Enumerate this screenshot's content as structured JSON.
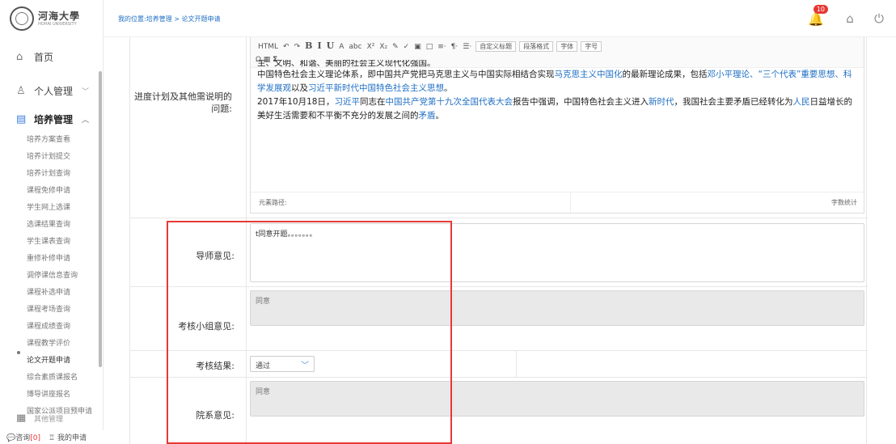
{
  "logo": {
    "cn": "河海大學",
    "en": "HOHAI UNIVERSITY"
  },
  "breadcrumb": "我的位置:培养管理 > 论文开题申请",
  "notifications": {
    "count": "10"
  },
  "sidebar": {
    "home": "首页",
    "personal": "个人管理",
    "training": "培养管理",
    "items": [
      "培养方案查看",
      "培养计划提交",
      "培养计划查询",
      "课程免修申请",
      "学生网上选课",
      "选课结果查询",
      "学生课表查询",
      "重修补修申请",
      "调停课信息查询",
      "课程补选申请",
      "课程考场查询",
      "课程成绩查询",
      "课程教学评价",
      "论文开题申请",
      "综合素质课报名",
      "博导讲座报名",
      "国家公派项目预申请"
    ],
    "next_partial": "其他管理",
    "bottom": {
      "consult": "咨询",
      "consult_count": "[0]",
      "my_apply": "我的申请"
    }
  },
  "editor": {
    "toolbar_row1": [
      "HTML",
      "↶",
      "↷",
      "B",
      "I",
      "U",
      "A",
      "abc",
      "X²",
      "X₂",
      "✎",
      "✓",
      "▣",
      "□",
      "≡·",
      "¶·",
      "☰·"
    ],
    "selects": [
      "自定义标题",
      "段落格式",
      "字体",
      "字号"
    ],
    "line0": "主、文明、和谐、美丽的社会主义现代化强国。",
    "para1_a": "中国特色社会主义理论体系，即中国共产党把马克思主义与中国实际相结合实现",
    "para1_link1": "马克思主义中国化",
    "para1_b": "的最新理论成果，包括",
    "para1_link2": "邓小平理论、“三个代表”重要思想、科学发展观",
    "para1_c": "以及",
    "para1_link3": "习近平新时代中国特色社会主义思想",
    "para1_d": "。",
    "para2_a": "2017年10月18日，",
    "para2_link1": "习近平",
    "para2_b": "同志在",
    "para2_link2": "中国共产党第十九次全国代表大会",
    "para2_c": "报告中强调，中国特色社会主义进入",
    "para2_link3": "新时代",
    "para2_d": "，我国社会主要矛盾已经转化为",
    "para2_link4": "人民",
    "para2_e": "日益增长的美好生活需要和不平衡不充分的发展之间的",
    "para2_link5": "矛盾",
    "para2_f": "。",
    "path_label": "元素路径:",
    "count_label": "字数统计"
  },
  "form": {
    "progress_label": "进度计划及其他需说明的问题:",
    "advisor_label": "导师意见:",
    "advisor_value": "t同意开题。。。。。。。",
    "group_label": "考核小组意见:",
    "group_value": "同意",
    "result_label": "考核结果:",
    "result_value": "通过",
    "dept_label": "院系意见:",
    "dept_value": "同意"
  },
  "colors": {
    "link": "#1f6fc4",
    "highlight": "#e53935",
    "badge": "#e53935"
  }
}
